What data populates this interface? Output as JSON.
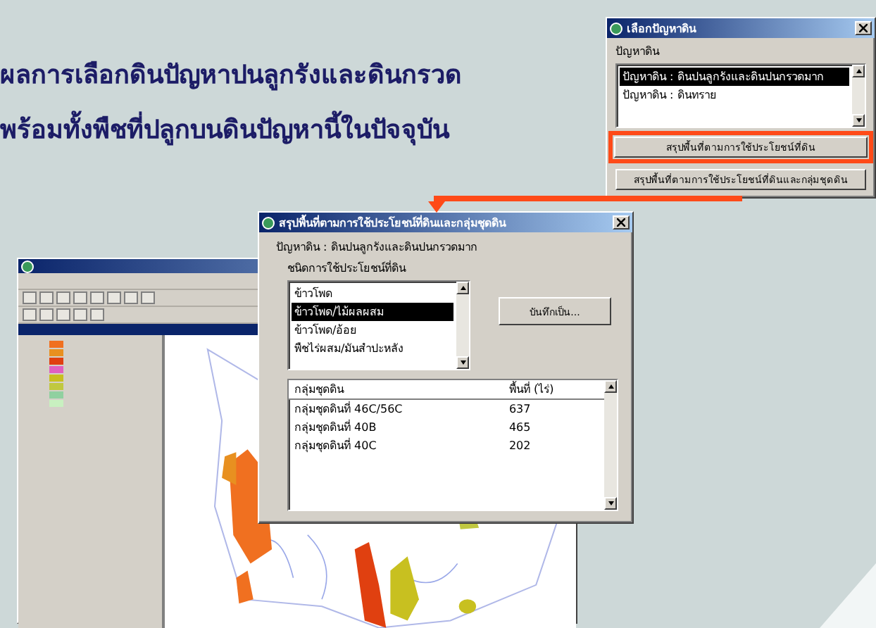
{
  "heading": [
    "ผลการเลือกดินปัญหาปนลูกรังและดินกรวด",
    "พร้อมทั้งพืชที่ปลูกบนดินปัญหานี้ในปัจจุบัน"
  ],
  "soil_dialog": {
    "title": "เลือกปัญหาดิน",
    "group_label": "ปัญหาดิน",
    "items": [
      {
        "label": "ปัญหาดิน : ดินปนลูกรังและดินปนกรวดมาก",
        "selected": true
      },
      {
        "label": "ปัญหาดิน : ดินทราย",
        "selected": false
      }
    ],
    "buttons": [
      {
        "label": "สรุปพื้นที่ตามการใช้ประโยชน์ที่ดิน",
        "highlighted": true
      },
      {
        "label": "สรุปพื้นที่ตามการใช้ประโยชน์ที่ดินและกลุ่มชุดดิน",
        "highlighted": false
      }
    ]
  },
  "summary_dialog": {
    "title": "สรุปพื้นที่ตามการใช้ประโยชน์ที่ดินและกลุ่มชุดดิน",
    "problem": "ปัญหาดิน : ดินปนลูกรังและดินปนกรวดมาก",
    "landuse_label": "ชนิดการใช้ประโยชน์ที่ดิน",
    "landuse_items": [
      {
        "label": "ข้าวโพด",
        "selected": false
      },
      {
        "label": "ข้าวโพด/ไม้ผลผสม",
        "selected": true
      },
      {
        "label": "ข้าวโพด/อ้อย",
        "selected": false
      },
      {
        "label": "พืชไร่ผสม/มันสำปะหลัง",
        "selected": false
      }
    ],
    "save_button": "บันทึกเป็น...",
    "table": {
      "columns": [
        "กลุ่มชุดดิน",
        "พื้นที่ (ไร่)"
      ],
      "rows": [
        [
          "กลุ่มชุดดินที่ 46C/56C",
          "637"
        ],
        [
          "กลุ่มชุดดินที่ 40B",
          "465"
        ],
        [
          "กลุ่มชุดดินที่ 40C",
          "202"
        ]
      ]
    }
  },
  "gis_window": {
    "legend": [
      {
        "color": "#f07020"
      },
      {
        "color": "#e89020"
      },
      {
        "color": "#e04010"
      },
      {
        "color": "#e060c0"
      },
      {
        "color": "#c8c020"
      },
      {
        "color": "#c0c840"
      },
      {
        "color": "#90d0a0"
      },
      {
        "color": "#c8f0c0"
      }
    ]
  }
}
